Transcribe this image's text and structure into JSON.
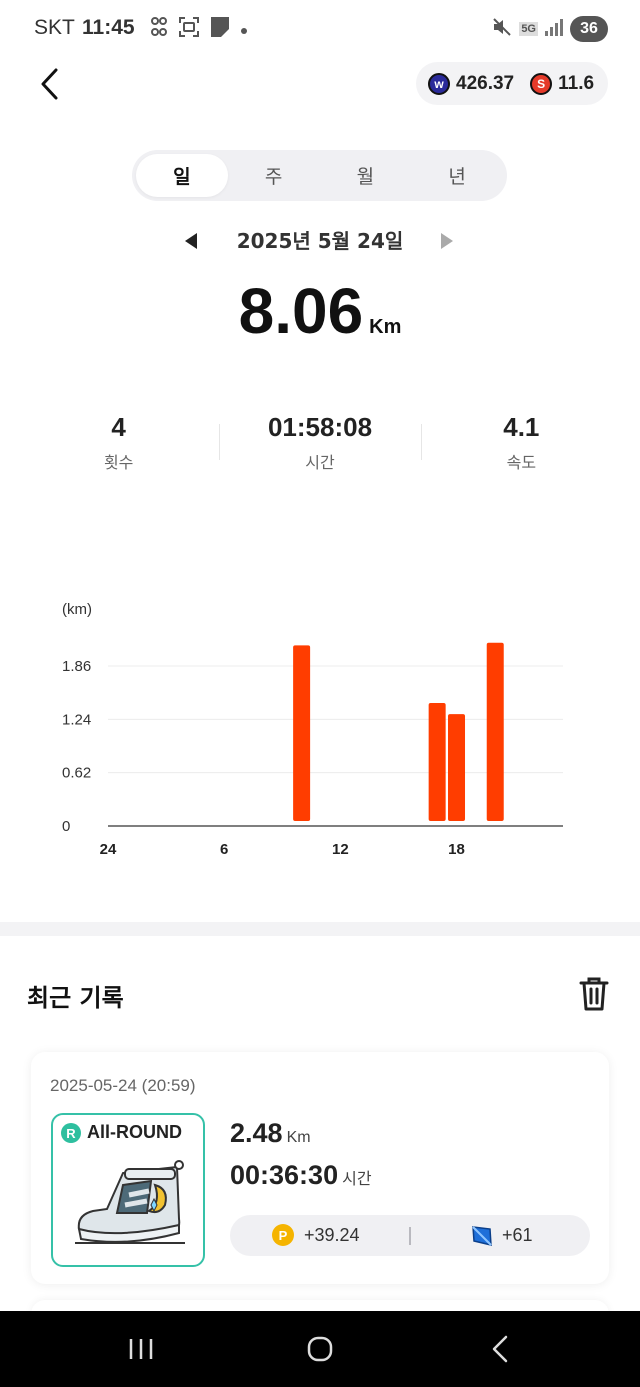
{
  "status_bar": {
    "carrier": "SKT",
    "time": "11:45",
    "network": "5G",
    "battery": "36"
  },
  "header": {
    "coin_w_value": "426.37",
    "coin_s_value": "11.6"
  },
  "tabs": [
    {
      "label": "일",
      "active": true
    },
    {
      "label": "주",
      "active": false
    },
    {
      "label": "월",
      "active": false
    },
    {
      "label": "년",
      "active": false
    }
  ],
  "date": {
    "label": "2025년 5월 24일"
  },
  "total": {
    "value": "8.06",
    "unit": "Km"
  },
  "stats": [
    {
      "value": "4",
      "label": "횟수"
    },
    {
      "value": "01:58:08",
      "label": "시간"
    },
    {
      "value": "4.1",
      "label": "속도"
    }
  ],
  "chart_data": {
    "type": "bar",
    "ylabel": "(km)",
    "y_ticks": [
      "0",
      "0.62",
      "1.24",
      "1.86"
    ],
    "ylim": [
      0,
      1.86
    ],
    "x_ticks": [
      "24",
      "6",
      "12",
      "18"
    ],
    "bar_color": "#ff3d00",
    "x": [
      10,
      17,
      18,
      20
    ],
    "values": [
      2.1,
      1.43,
      1.3,
      2.13
    ]
  },
  "recent": {
    "title": "최근 기록",
    "records": [
      {
        "date": "2025-05-24 (20:59)",
        "shoe_badge": "R",
        "shoe_type": "All-ROUND",
        "distance": "2.48",
        "distance_unit": "Km",
        "time": "00:36:30",
        "time_unit": "시간",
        "points": "+39.24",
        "gems": "+61"
      }
    ]
  },
  "colors": {
    "accent": "#ff3d00",
    "shoe_border": "#35c1a8",
    "point_coin": "#f5b400"
  }
}
